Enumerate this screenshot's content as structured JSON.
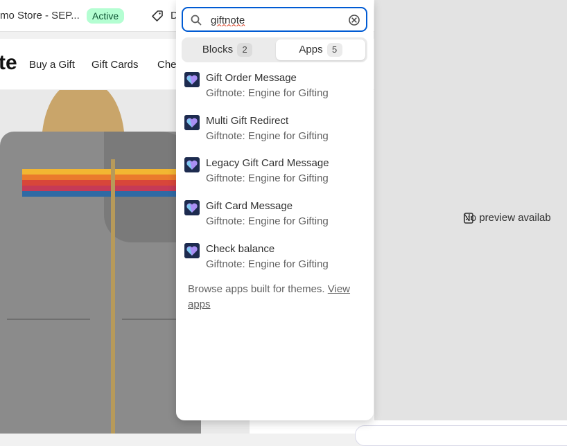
{
  "topbar": {
    "store_name": "mo Store - SEP...",
    "status_badge": "Active",
    "tag_text": "D"
  },
  "site_preview": {
    "logo_fragment": "te",
    "nav_links": [
      "Buy a Gift",
      "Gift Cards",
      "Che"
    ]
  },
  "right_panel": {
    "no_preview_text": "No preview availab"
  },
  "popover": {
    "search": {
      "value": "giftnote",
      "placeholder": "Search"
    },
    "tabs": [
      {
        "label": "Blocks",
        "count": "2",
        "selected": false
      },
      {
        "label": "Apps",
        "count": "5",
        "selected": true
      }
    ],
    "items": [
      {
        "title": "Gift Order Message",
        "subtitle": "Giftnote: Engine for Gifting"
      },
      {
        "title": "Multi Gift Redirect",
        "subtitle": "Giftnote: Engine for Gifting"
      },
      {
        "title": "Legacy Gift Card Message",
        "subtitle": "Giftnote: Engine for Gifting"
      },
      {
        "title": "Gift Card Message",
        "subtitle": "Giftnote: Engine for Gifting"
      },
      {
        "title": "Check balance",
        "subtitle": "Giftnote: Engine for Gifting"
      }
    ],
    "footer": {
      "text": "Browse apps built for themes.",
      "link": "View apps"
    }
  },
  "colors": {
    "focus_ring": "#005bd3",
    "active_badge_bg": "#b4fed2",
    "active_badge_text": "#0c5132"
  },
  "icons": {
    "search": "search-icon",
    "clear": "clear-circle-icon",
    "app": "giftnote-heart-icon",
    "tag": "tag-icon",
    "no_preview": "no-preview-icon"
  }
}
